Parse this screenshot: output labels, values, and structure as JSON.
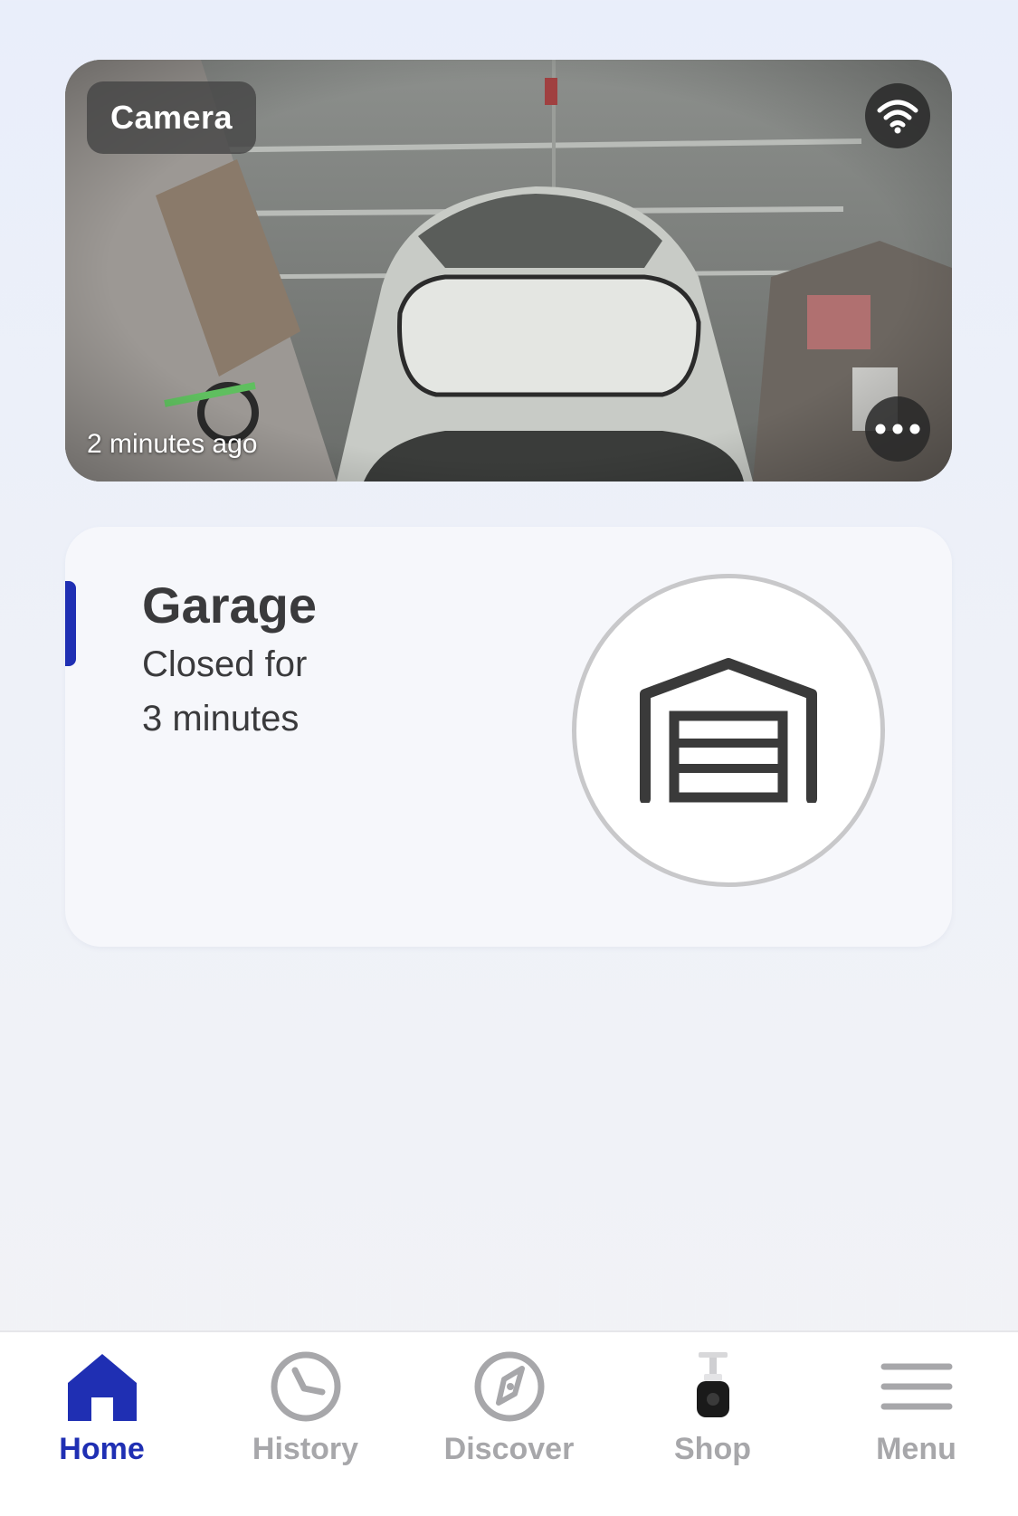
{
  "colors": {
    "accent": "#1f2fb3",
    "inactive": "#a7a7aa",
    "text_dark": "#3a3a3c"
  },
  "camera": {
    "label": "Camera",
    "last_update": "2 minutes ago",
    "wifi_icon": "wifi-icon",
    "more_icon": "more-icon"
  },
  "garage": {
    "title": "Garage",
    "status_line1": "Closed for",
    "status_line2": "3 minutes",
    "icon": "garage-door-icon"
  },
  "nav": {
    "items": [
      {
        "label": "Home",
        "icon": "home-icon",
        "active": true
      },
      {
        "label": "History",
        "icon": "clock-icon",
        "active": false
      },
      {
        "label": "Discover",
        "icon": "compass-icon",
        "active": false
      },
      {
        "label": "Shop",
        "icon": "camera-product-icon",
        "active": false
      },
      {
        "label": "Menu",
        "icon": "hamburger-icon",
        "active": false
      }
    ]
  }
}
